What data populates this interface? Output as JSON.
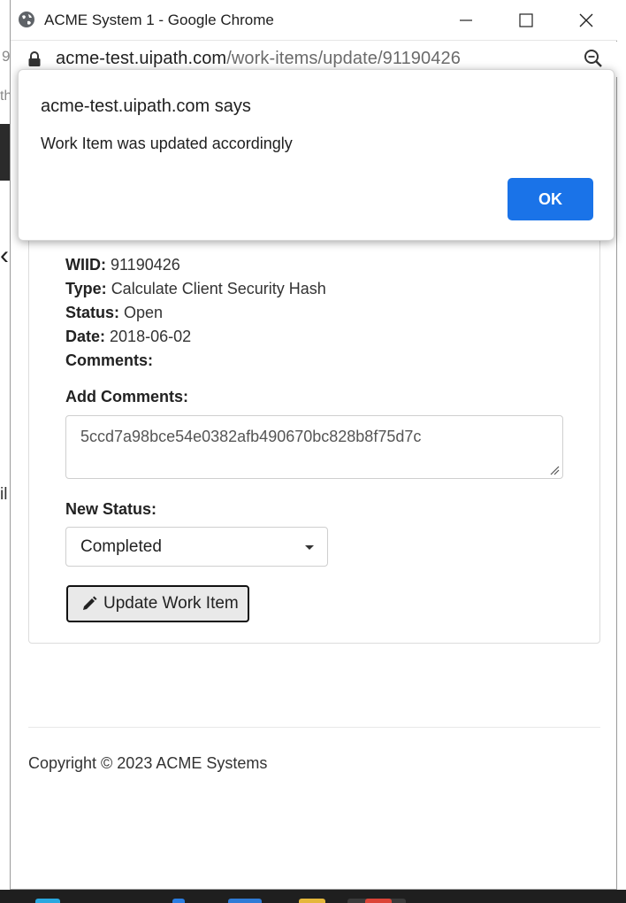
{
  "window": {
    "title": "ACME System 1 - Google Chrome",
    "url_host": "acme-test.uipath.com",
    "url_path": "/work-items/update/91190426"
  },
  "background": {
    "frag_top": "9",
    "frag_mid": "th",
    "frag_low": "il"
  },
  "dialog": {
    "title": "acme-test.uipath.com says",
    "message": "Work Item was updated accordingly",
    "ok_label": "OK",
    "ok_color": "#1a73e8"
  },
  "work_item": {
    "wiid_label": "WIID:",
    "wiid_value": "91190426",
    "type_label": "Type:",
    "type_value": "Calculate Client Security Hash",
    "status_label": "Status:",
    "status_value": "Open",
    "date_label": "Date:",
    "date_value": "2018-06-02",
    "comments_label": "Comments:"
  },
  "form": {
    "add_comments_label": "Add Comments:",
    "comment_value": "5ccd7a98bce54e0382afb490670bc828b8f75d7c",
    "new_status_label": "New Status:",
    "status_selected": "Completed",
    "update_button_label": "Update Work Item"
  },
  "footer": {
    "copyright": "Copyright © 2023 ACME Systems"
  },
  "icons": {
    "globe": "globe-icon",
    "lock": "lock-icon",
    "zoom": "zoom-icon",
    "pencil": "pencil-icon"
  }
}
